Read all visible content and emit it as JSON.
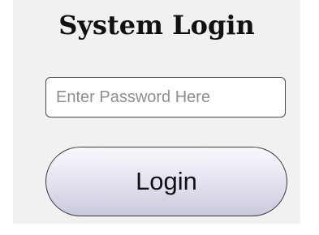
{
  "app": {
    "title": "System Login"
  },
  "password": {
    "value": "",
    "placeholder": "Enter Password Here"
  },
  "actions": {
    "login_label": "Login"
  }
}
